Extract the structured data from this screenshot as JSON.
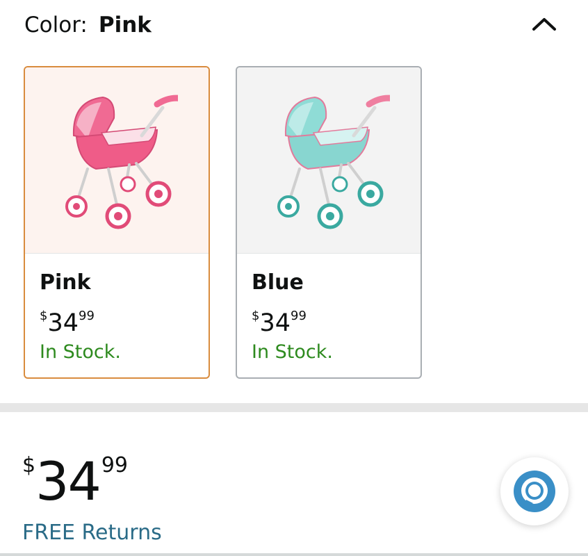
{
  "color_selector": {
    "label": "Color:",
    "selected_value": "Pink",
    "toggle_icon": "chevron-up-icon"
  },
  "swatches": [
    {
      "name": "Pink",
      "price_symbol": "$",
      "price_whole": "34",
      "price_fraction": "99",
      "availability": "In Stock.",
      "image": "pink-doll-stroller",
      "selected": true,
      "accent_color": "#e8507a"
    },
    {
      "name": "Blue",
      "price_symbol": "$",
      "price_whole": "34",
      "price_fraction": "99",
      "availability": "In Stock.",
      "image": "blue-doll-stroller",
      "selected": false,
      "accent_color": "#7fd3cf"
    }
  ],
  "price": {
    "symbol": "$",
    "whole": "34",
    "fraction": "99"
  },
  "returns": {
    "label": "FREE Returns"
  },
  "alexa": {
    "icon": "alexa-icon",
    "color": "#3a8fc7"
  },
  "colors": {
    "selected_border": "#d98c3e",
    "in_stock": "#2d8a1e",
    "link": "#2a6b87"
  }
}
